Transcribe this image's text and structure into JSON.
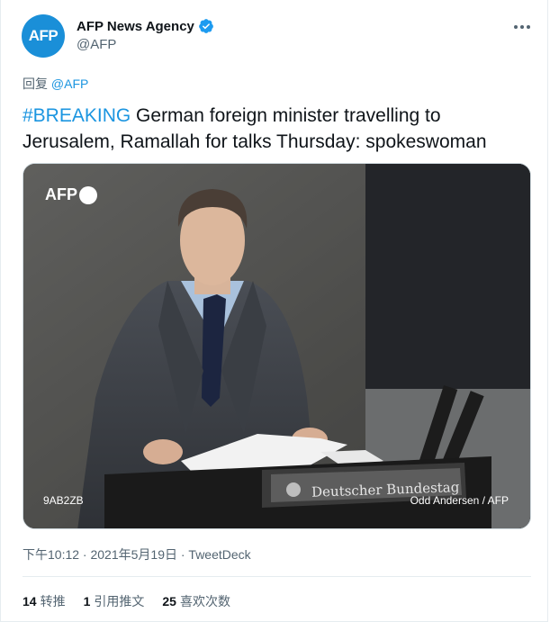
{
  "account": {
    "avatar_text": "AFP",
    "name": "AFP News Agency",
    "handle": "@AFP",
    "verified": true,
    "brand_color": "#1a8fd8"
  },
  "tweet": {
    "reply_prefix": "回复",
    "reply_handle": "@AFP",
    "hashtag": "#BREAKING",
    "text": " German foreign minister travelling to Jerusalem, Ramallah for talks Thursday: spokeswoman"
  },
  "media": {
    "logo_text": "AFP",
    "photo_id": "9AB2ZB",
    "credit": "Odd Andersen / AFP",
    "lectern_sign": "Deutscher Bundestag"
  },
  "meta": {
    "timestamp": "下午10:12 · 2021年5月19日 · TweetDeck"
  },
  "stats": {
    "retweets_count": "14",
    "retweets_label": "转推",
    "quotes_count": "1",
    "quotes_label": "引用推文",
    "likes_count": "25",
    "likes_label": "喜欢次数"
  },
  "colors": {
    "link": "#1b95e0",
    "secondary_text": "#536471"
  }
}
